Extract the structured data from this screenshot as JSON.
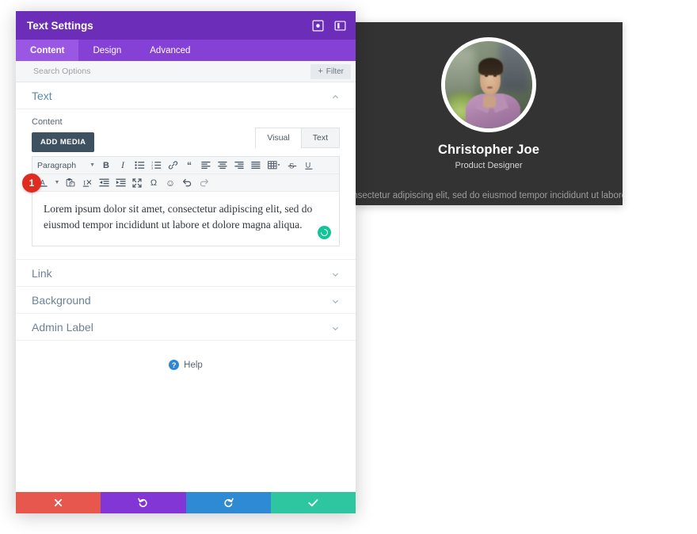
{
  "modal": {
    "title": "Text Settings",
    "header_icons": [
      {
        "name": "expand-icon",
        "label": "Expand"
      },
      {
        "name": "split-view-icon",
        "label": "Split View"
      }
    ],
    "tabs": [
      {
        "label": "Content",
        "active": true
      },
      {
        "label": "Design",
        "active": false
      },
      {
        "label": "Advanced",
        "active": false
      }
    ],
    "search": {
      "placeholder": "Search Options",
      "value": "",
      "filter_label": "Filter",
      "filter_plus": "+"
    },
    "sections": [
      {
        "label": "Text",
        "open": true,
        "chevron": "up"
      },
      {
        "label": "Link",
        "open": false,
        "chevron": "down"
      },
      {
        "label": "Background",
        "open": false,
        "chevron": "down"
      },
      {
        "label": "Admin Label",
        "open": false,
        "chevron": "down"
      }
    ],
    "content_field": {
      "label": "Content",
      "add_media_label": "ADD MEDIA",
      "editor_tabs": [
        {
          "label": "Visual",
          "active": true
        },
        {
          "label": "Text",
          "active": false
        }
      ],
      "format_select": "Paragraph",
      "toolbar_row1": [
        {
          "name": "bold-icon",
          "glyph": "B"
        },
        {
          "name": "italic-icon",
          "glyph": "I"
        },
        {
          "name": "bulleted-list-icon",
          "glyph": "list-ul"
        },
        {
          "name": "numbered-list-icon",
          "glyph": "list-ol"
        },
        {
          "name": "link-icon",
          "glyph": "link"
        },
        {
          "name": "blockquote-icon",
          "glyph": "quote"
        },
        {
          "name": "align-left-icon",
          "glyph": "align-left"
        },
        {
          "name": "align-center-icon",
          "glyph": "align-center"
        },
        {
          "name": "align-right-icon",
          "glyph": "align-right"
        },
        {
          "name": "align-justify-icon",
          "glyph": "align-justify"
        },
        {
          "name": "table-icon",
          "glyph": "table"
        },
        {
          "name": "strikethrough-icon",
          "glyph": "S"
        },
        {
          "name": "underline-icon",
          "glyph": "U"
        }
      ],
      "toolbar_row2": [
        {
          "name": "text-color-icon",
          "glyph": "A"
        },
        {
          "name": "paste-as-text-icon",
          "glyph": "paste"
        },
        {
          "name": "clear-formatting-icon",
          "glyph": "eraser"
        },
        {
          "name": "outdent-icon",
          "glyph": "outdent"
        },
        {
          "name": "indent-icon",
          "glyph": "indent"
        },
        {
          "name": "fullscreen-icon",
          "glyph": "expand"
        },
        {
          "name": "special-character-icon",
          "glyph": "Ω"
        },
        {
          "name": "emoji-icon",
          "glyph": "☺"
        },
        {
          "name": "undo-icon",
          "glyph": "undo"
        },
        {
          "name": "redo-icon",
          "glyph": "redo"
        }
      ],
      "editor_value": "Lorem ipsum dolor sit amet, consectetur adipiscing elit, sed do eiusmod tempor incididunt ut labore et dolore magna aliqua."
    },
    "step_badge": "1",
    "help_label": "Help",
    "help_icon_glyph": "?",
    "footer_buttons": [
      {
        "name": "cancel-button",
        "icon": "close-icon",
        "color": "#e8574e"
      },
      {
        "name": "undo-button",
        "icon": "undo-icon",
        "color": "#8236d6"
      },
      {
        "name": "redo-button",
        "icon": "redo-icon",
        "color": "#2f8ad4"
      },
      {
        "name": "save-button",
        "icon": "check-icon",
        "color": "#2ec6a0"
      }
    ]
  },
  "preview": {
    "name": "Christopher Joe",
    "role": "Product Designer",
    "body": "Lorem ipsum dolor sit amet, consectetur adipiscing elit, sed do eiusmod tempor incididunt ut labore et dolore magna aliqua.",
    "background_color": "#333333"
  }
}
